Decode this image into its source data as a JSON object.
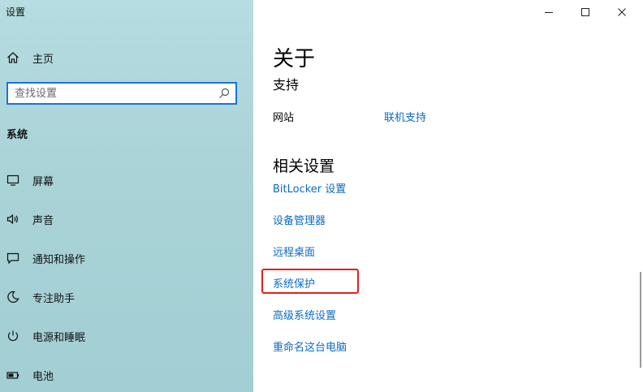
{
  "app": {
    "title": "设置"
  },
  "sidebar": {
    "home_label": "主页",
    "search_placeholder": "查找设置",
    "section_header": "系统",
    "items": [
      {
        "label": "屏幕",
        "icon": "monitor-icon"
      },
      {
        "label": "声音",
        "icon": "speaker-icon"
      },
      {
        "label": "通知和操作",
        "icon": "notification-icon"
      },
      {
        "label": "专注助手",
        "icon": "moon-icon"
      },
      {
        "label": "电源和睡眠",
        "icon": "power-icon"
      },
      {
        "label": "电池",
        "icon": "battery-icon"
      }
    ]
  },
  "window_controls": [
    "minimize-icon",
    "maximize-icon",
    "close-icon"
  ],
  "main": {
    "title": "关于",
    "support": {
      "heading": "支持",
      "label": "网站",
      "link": "联机支持"
    },
    "related": {
      "heading": "相关设置",
      "links": [
        "BitLocker 设置",
        "设备管理器",
        "远程桌面",
        "系统保护",
        "高级系统设置",
        "重命名这台电脑"
      ]
    }
  },
  "colors": {
    "sidebar_bg": "#a9d3d7",
    "link": "#0b6bc1",
    "search_border": "#1a73d9",
    "highlight": "#e0201d"
  }
}
